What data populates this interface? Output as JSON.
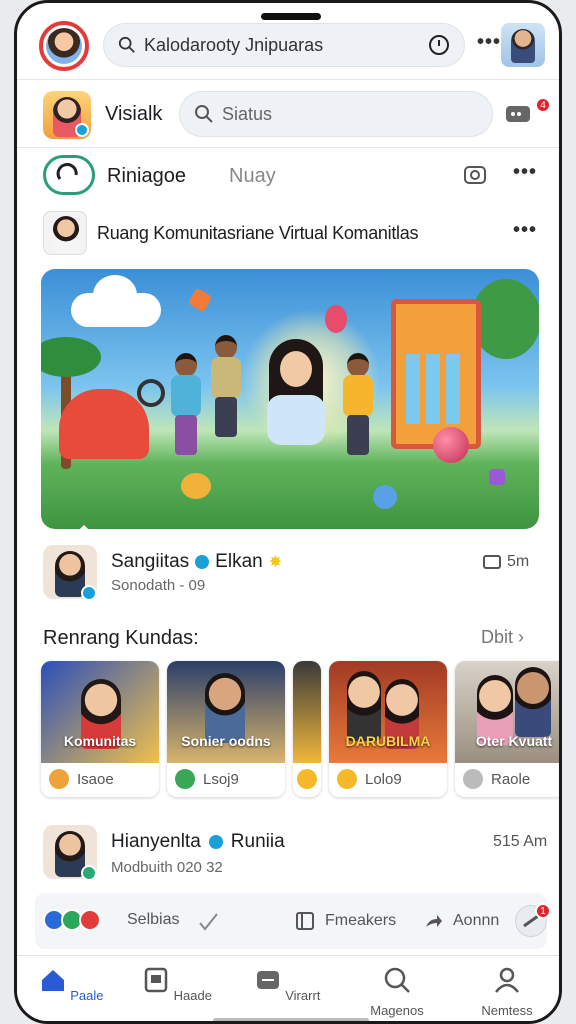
{
  "topbar": {
    "search_text": "Kalodarooty Jnipuaras",
    "more": "•••"
  },
  "status": {
    "name": "Visialk",
    "placeholder": "Siatus",
    "badge": "4"
  },
  "page": {
    "name": "Riniagoe",
    "sub": "Nuay",
    "more": "•••"
  },
  "post": {
    "title": "Ruang Komunitasriane Virtual Komanitlas",
    "more": "•••"
  },
  "author": {
    "name": "Sangiitas",
    "name2": "Elkan",
    "time": "Sonodath - 09",
    "right": "5m"
  },
  "section": {
    "title": "Renrang Kundas:",
    "more": "Dbit"
  },
  "cards": [
    {
      "caption": "Komunitas",
      "foot": "Isaoe",
      "color": "#f0a23a"
    },
    {
      "caption": "Sonier oodns",
      "foot": "Lsoj9",
      "color": "#3aa757"
    },
    {
      "caption": "",
      "foot": "",
      "color": "#f5b829"
    },
    {
      "caption": "DARUBILMA",
      "foot": "Lolo9",
      "color": "#f5b829"
    },
    {
      "caption": "Oter Kvuatt",
      "foot": "Raole",
      "color": "#bbbbbb"
    }
  ],
  "post2": {
    "name": "Hianyenlta",
    "name2": "Runiia",
    "time": "Modbuith 020 32",
    "right": "515 Am"
  },
  "actions": {
    "label1": "Selbias",
    "label2": "Fmeakers",
    "label3": "Aonnn",
    "badge": "1"
  },
  "nav": [
    {
      "label": "Paale"
    },
    {
      "label": "Haade"
    },
    {
      "label": "Virarrt"
    },
    {
      "label": "Magenos"
    },
    {
      "label": "Nemtess"
    }
  ]
}
